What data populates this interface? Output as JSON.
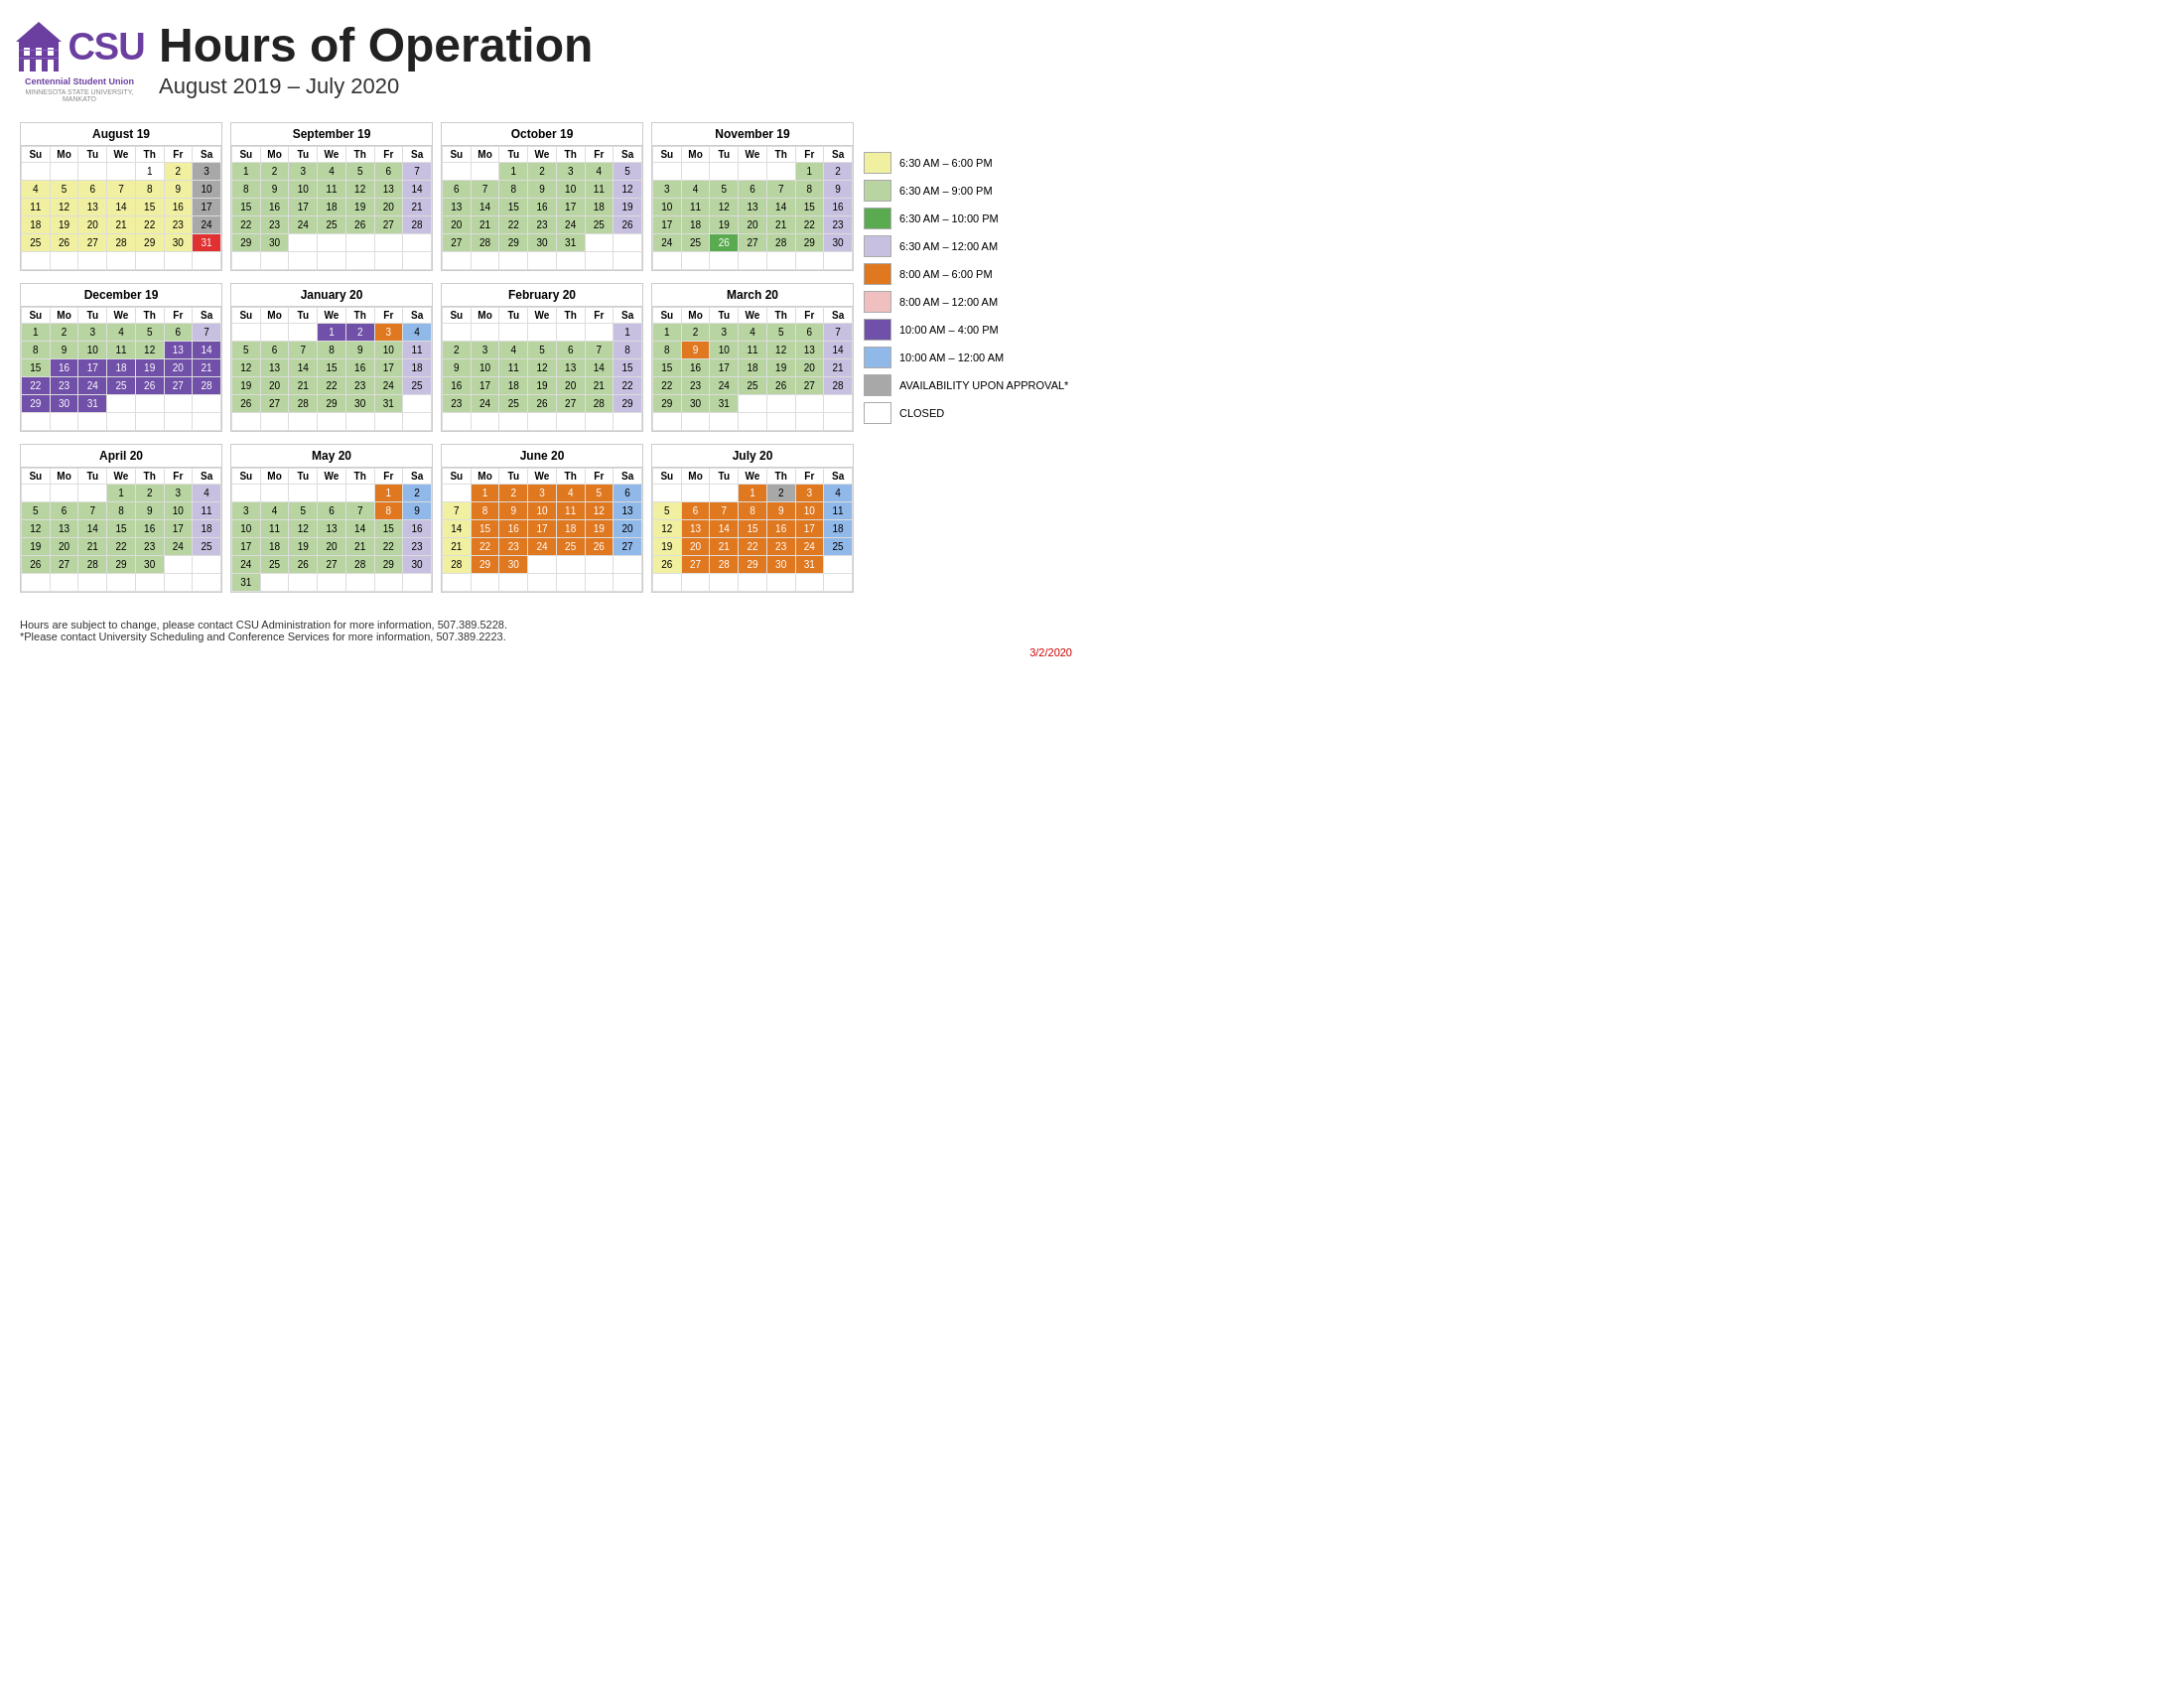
{
  "header": {
    "title": "Hours of Operation",
    "subtitle": "August 2019 – July 2020",
    "logo_csu": "CSU",
    "logo_subtitle": "Centennial Student Union",
    "logo_subtitle2": "MINNESOTA STATE UNIVERSITY, MANKATO"
  },
  "legend": [
    {
      "color": "c-yellow",
      "text": "6:30 AM – 6:00 PM"
    },
    {
      "color": "c-green-light",
      "text": "6:30 AM – 9:00 PM"
    },
    {
      "color": "c-green",
      "text": "6:30 AM – 10:00 PM"
    },
    {
      "color": "c-lavender",
      "text": "6:30 AM – 12:00 AM"
    },
    {
      "color": "c-orange",
      "text": "8:00 AM – 6:00 PM"
    },
    {
      "color": "c-pink",
      "text": "8:00 AM – 12:00 AM"
    },
    {
      "color": "c-purple",
      "text": "10:00 AM – 4:00 PM"
    },
    {
      "color": "c-blue",
      "text": "10:00 AM – 12:00 AM"
    },
    {
      "color": "c-gray",
      "text": "AVAILABILITY UPON APPROVAL*"
    },
    {
      "color": "empty",
      "text": "CLOSED"
    }
  ],
  "footer": {
    "line1": "Hours are subject to change, please contact CSU Administration for more information, 507.389.5228.",
    "line2": "*Please contact University Scheduling and Conference Services for more information, 507.389.2223.",
    "date": "3/2/2020"
  },
  "calendars": {
    "row1": [
      {
        "title": "August 19",
        "headers": [
          "Su",
          "Mo",
          "Tu",
          "We",
          "Th",
          "Fr",
          "Sa"
        ],
        "weeks": [
          [
            null,
            null,
            null,
            null,
            "1",
            "2",
            "3"
          ],
          [
            "4",
            "5",
            "6",
            "7",
            "8",
            "9",
            "10"
          ],
          [
            "11",
            "12",
            "13",
            "14",
            "15",
            "16",
            "17"
          ],
          [
            "18",
            "19",
            "20",
            "21",
            "22",
            "23",
            "24"
          ],
          [
            "25",
            "26",
            "27",
            "28",
            "29",
            "30",
            "31"
          ],
          [
            null,
            null,
            null,
            null,
            null,
            null,
            null
          ]
        ],
        "colors": {
          "1-Fr": "c-yellow",
          "2-Sa": "c-gray",
          "3-Sa2": "c-gray",
          "4-Su": "c-yellow",
          "5-Mo": "c-yellow",
          "6-Tu": "c-yellow",
          "7-We": "c-yellow",
          "8-Th": "c-yellow",
          "9-Fr": "c-yellow",
          "10-Sa": "c-gray",
          "11-Su": "c-yellow",
          "12-Mo": "c-yellow",
          "13-Tu": "c-yellow",
          "14-We": "c-yellow",
          "15-Th": "c-yellow",
          "16-Fr": "c-yellow",
          "17-Sa": "c-gray",
          "18-Su": "c-yellow",
          "19-Mo": "c-yellow",
          "20-Tu": "c-yellow",
          "21-We": "c-yellow",
          "22-Th": "c-yellow",
          "23-Fr": "c-yellow",
          "24-Sa": "c-gray",
          "25-Su": "c-yellow",
          "26-Mo": "c-yellow",
          "27-Tu": "c-yellow",
          "28-We": "c-yellow",
          "29-Th": "c-yellow",
          "30-Fr": "c-yellow",
          "31-Sa": "c-red"
        }
      },
      {
        "title": "September 19",
        "headers": [
          "Su",
          "Mo",
          "Tu",
          "We",
          "Th",
          "Fr",
          "Sa"
        ],
        "weeks": [
          [
            "1",
            "2",
            "3",
            "4",
            "5",
            "6",
            "7"
          ],
          [
            "8",
            "9",
            "10",
            "11",
            "12",
            "13",
            "14"
          ],
          [
            "15",
            "16",
            "17",
            "18",
            "19",
            "20",
            "21"
          ],
          [
            "22",
            "23",
            "24",
            "25",
            "26",
            "27",
            "28"
          ],
          [
            "29",
            "30",
            null,
            null,
            null,
            null,
            null
          ],
          [
            null,
            null,
            null,
            null,
            null,
            null,
            null
          ]
        ]
      },
      {
        "title": "October 19",
        "headers": [
          "Su",
          "Mo",
          "Tu",
          "We",
          "Th",
          "Fr",
          "Sa"
        ],
        "weeks": [
          [
            null,
            null,
            "1",
            "2",
            "3",
            "4",
            "5"
          ],
          [
            "6",
            "7",
            "8",
            "9",
            "10",
            "11",
            "12"
          ],
          [
            "13",
            "14",
            "15",
            "16",
            "17",
            "18",
            "19"
          ],
          [
            "20",
            "21",
            "22",
            "23",
            "24",
            "25",
            "26"
          ],
          [
            "27",
            "28",
            "29",
            "30",
            "31",
            null,
            null
          ],
          [
            null,
            null,
            null,
            null,
            null,
            null,
            null
          ]
        ]
      },
      {
        "title": "November 19",
        "headers": [
          "Su",
          "Mo",
          "Tu",
          "We",
          "Th",
          "Fr",
          "Sa"
        ],
        "weeks": [
          [
            null,
            null,
            null,
            null,
            null,
            "1",
            "2"
          ],
          [
            "3",
            "4",
            "5",
            "6",
            "7",
            "8",
            "9"
          ],
          [
            "10",
            "11",
            "12",
            "13",
            "14",
            "15",
            "16"
          ],
          [
            "17",
            "18",
            "19",
            "20",
            "21",
            "22",
            "23"
          ],
          [
            "24",
            "25",
            "26",
            "27",
            "28",
            "29",
            "30"
          ],
          [
            null,
            null,
            null,
            null,
            null,
            null,
            null
          ]
        ]
      }
    ],
    "row2": [
      {
        "title": "December 19",
        "headers": [
          "Su",
          "Mo",
          "Tu",
          "We",
          "Th",
          "Fr",
          "Sa"
        ],
        "weeks": [
          [
            "1",
            "2",
            "3",
            "4",
            "5",
            "6",
            "7"
          ],
          [
            "8",
            "9",
            "10",
            "11",
            "12",
            "13",
            "14"
          ],
          [
            "15",
            "16",
            "17",
            "18",
            "19",
            "20",
            "21"
          ],
          [
            "22",
            "23",
            "24",
            "25",
            "26",
            "27",
            "28"
          ],
          [
            "29",
            "30",
            "31",
            null,
            null,
            null,
            null
          ],
          [
            null,
            null,
            null,
            null,
            null,
            null,
            null
          ]
        ]
      },
      {
        "title": "January 20",
        "headers": [
          "Su",
          "Mo",
          "Tu",
          "We",
          "Th",
          "Fr",
          "Sa"
        ],
        "weeks": [
          [
            null,
            null,
            null,
            "1",
            "2",
            "3",
            "4"
          ],
          [
            "5",
            "6",
            "7",
            "8",
            "9",
            "10",
            "11"
          ],
          [
            "12",
            "13",
            "14",
            "15",
            "16",
            "17",
            "18"
          ],
          [
            "19",
            "20",
            "21",
            "22",
            "23",
            "24",
            "25"
          ],
          [
            "26",
            "27",
            "28",
            "29",
            "30",
            "31",
            null
          ],
          [
            null,
            null,
            null,
            null,
            null,
            null,
            null
          ]
        ]
      },
      {
        "title": "February 20",
        "headers": [
          "Su",
          "Mo",
          "Tu",
          "We",
          "Th",
          "Fr",
          "Sa"
        ],
        "weeks": [
          [
            null,
            null,
            null,
            null,
            null,
            null,
            "1"
          ],
          [
            "2",
            "3",
            "4",
            "5",
            "6",
            "7",
            "8"
          ],
          [
            "9",
            "10",
            "11",
            "12",
            "13",
            "14",
            "15"
          ],
          [
            "16",
            "17",
            "18",
            "19",
            "20",
            "21",
            "22"
          ],
          [
            "23",
            "24",
            "25",
            "26",
            "27",
            "28",
            "29"
          ],
          [
            null,
            null,
            null,
            null,
            null,
            null,
            null
          ]
        ]
      },
      {
        "title": "March 20",
        "headers": [
          "Su",
          "Mo",
          "Tu",
          "We",
          "Th",
          "Fr",
          "Sa"
        ],
        "weeks": [
          [
            "1",
            "2",
            "3",
            "4",
            "5",
            "6",
            "7"
          ],
          [
            "8",
            "9",
            "10",
            "11",
            "12",
            "13",
            "14"
          ],
          [
            "15",
            "16",
            "17",
            "18",
            "19",
            "20",
            "21"
          ],
          [
            "22",
            "23",
            "24",
            "25",
            "26",
            "27",
            "28"
          ],
          [
            "29",
            "30",
            "31",
            null,
            null,
            null,
            null
          ],
          [
            null,
            null,
            null,
            null,
            null,
            null,
            null
          ]
        ]
      }
    ],
    "row3": [
      {
        "title": "April 20",
        "headers": [
          "Su",
          "Mo",
          "Tu",
          "We",
          "Th",
          "Fr",
          "Sa"
        ],
        "weeks": [
          [
            null,
            null,
            null,
            "1",
            "2",
            "3",
            "4"
          ],
          [
            "5",
            "6",
            "7",
            "8",
            "9",
            "10",
            "11"
          ],
          [
            "12",
            "13",
            "14",
            "15",
            "16",
            "17",
            "18"
          ],
          [
            "19",
            "20",
            "21",
            "22",
            "23",
            "24",
            "25"
          ],
          [
            "26",
            "27",
            "28",
            "29",
            "30",
            null,
            null
          ],
          [
            null,
            null,
            null,
            null,
            null,
            null,
            null
          ]
        ]
      },
      {
        "title": "May 20",
        "headers": [
          "Su",
          "Mo",
          "Tu",
          "We",
          "Th",
          "Fr",
          "Sa"
        ],
        "weeks": [
          [
            null,
            null,
            null,
            null,
            null,
            "1",
            "2"
          ],
          [
            "3",
            "4",
            "5",
            "6",
            "7",
            "8",
            "9"
          ],
          [
            "10",
            "11",
            "12",
            "13",
            "14",
            "15",
            "16"
          ],
          [
            "17",
            "18",
            "19",
            "20",
            "21",
            "22",
            "23"
          ],
          [
            "24",
            "25",
            "26",
            "27",
            "28",
            "29",
            "30"
          ],
          [
            "31",
            null,
            null,
            null,
            null,
            null,
            null
          ]
        ]
      },
      {
        "title": "June 20",
        "headers": [
          "Su",
          "Mo",
          "Tu",
          "We",
          "Th",
          "Fr",
          "Sa"
        ],
        "weeks": [
          [
            null,
            "1",
            "2",
            "3",
            "4",
            "5",
            "6"
          ],
          [
            "7",
            "8",
            "9",
            "10",
            "11",
            "12",
            "13"
          ],
          [
            "14",
            "15",
            "16",
            "17",
            "18",
            "19",
            "20"
          ],
          [
            "21",
            "22",
            "23",
            "24",
            "25",
            "26",
            "27"
          ],
          [
            "28",
            "29",
            "30",
            null,
            null,
            null,
            null
          ],
          [
            null,
            null,
            null,
            null,
            null,
            null,
            null
          ]
        ]
      },
      {
        "title": "July 20",
        "headers": [
          "Su",
          "Mo",
          "Tu",
          "We",
          "Th",
          "Fr",
          "Sa"
        ],
        "weeks": [
          [
            null,
            null,
            null,
            "1",
            "2",
            "3",
            "4"
          ],
          [
            "5",
            "6",
            "7",
            "8",
            "9",
            "10",
            "11"
          ],
          [
            "12",
            "13",
            "14",
            "15",
            "16",
            "17",
            "18"
          ],
          [
            "19",
            "20",
            "21",
            "22",
            "23",
            "24",
            "25"
          ],
          [
            "26",
            "27",
            "28",
            "29",
            "30",
            "31",
            null
          ],
          [
            null,
            null,
            null,
            null,
            null,
            null,
            null
          ]
        ]
      }
    ]
  }
}
